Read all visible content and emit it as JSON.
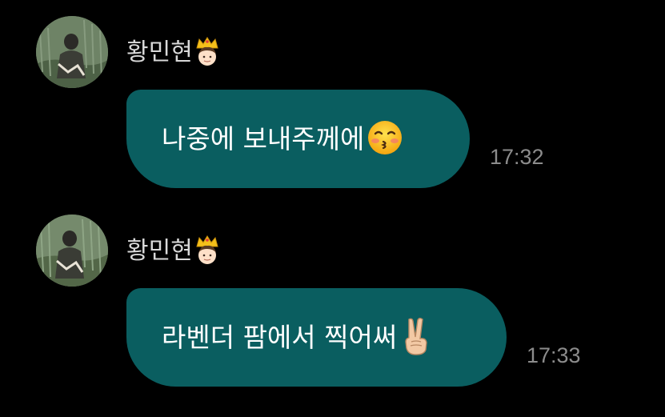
{
  "messages": [
    {
      "sender": "황민현",
      "sender_badge_icon": "crown-boy-emoji",
      "text": "나중에 보내주께에",
      "emoji_icon": "kissing-face-emoji",
      "time": "17:32"
    },
    {
      "sender": "황민현",
      "sender_badge_icon": "crown-boy-emoji",
      "text": "라벤더 팜에서 찍어써",
      "emoji_icon": "victory-hand-emoji",
      "time": "17:33"
    }
  ],
  "colors": {
    "background": "#000000",
    "bubble": "#0a5e60",
    "sender_text": "#d9d9d9",
    "message_text": "#ffffff",
    "time_text": "#8c8c8c"
  }
}
